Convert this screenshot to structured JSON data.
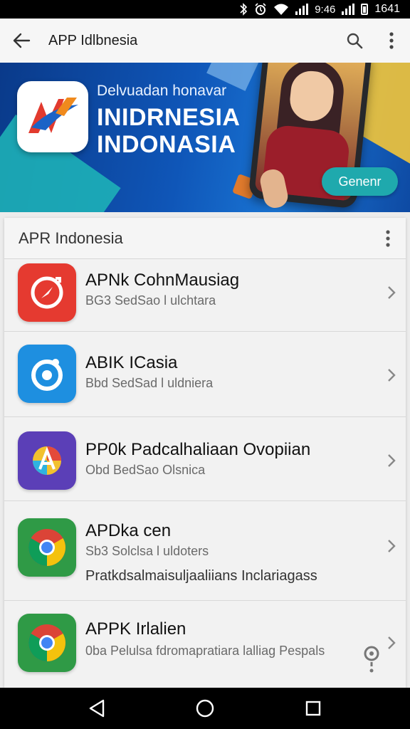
{
  "status_bar": {
    "time": "1641",
    "clock_small": "9:46",
    "icons": [
      "bluetooth-icon",
      "alarm-icon",
      "wifi-icon",
      "signal-icon",
      "signal-icon",
      "battery-icon"
    ]
  },
  "app_bar": {
    "title": "APP Idlbnesia",
    "back_icon": "back-arrow-icon",
    "actions": [
      "search-icon",
      "more-vert-icon"
    ]
  },
  "banner": {
    "subtitle": "Delvuadan honavar",
    "headline_1": "INIDRNESIA",
    "headline_2": "INDONASIA",
    "cta_label": "Genenr"
  },
  "list_card": {
    "title": "APR Indonesia",
    "items": [
      {
        "name": "APNk CohnMausiag",
        "desc": "BG3 SedSao l ulchtara",
        "extra": "",
        "icon": "compass-refresh-icon",
        "color": "#e53a30"
      },
      {
        "name": "ABIK ICasia",
        "desc": "Bbd SedSad l uldniera",
        "extra": "",
        "icon": "ring-camera-icon",
        "color": "#1e8fe0"
      },
      {
        "name": "PP0k Padcalhaliaan Ovopiian",
        "desc": "Obd BedSao Olsnica",
        "extra": "",
        "icon": "letter-a-icon",
        "color": "#5b3fb7"
      },
      {
        "name": "APDka cen",
        "desc": "Sb3 Solclsa l uldoters",
        "extra": "Pratkdsalmaisuljaaliians Inclariagass",
        "icon": "chrome-icon",
        "color": "#2f9a46"
      },
      {
        "name": "APPK Irlalien",
        "desc": "0ba Pelulsa fdromapratiara lalliag Pespals",
        "extra": "",
        "icon": "chrome-icon",
        "color": "#2f9a46"
      }
    ]
  },
  "nav_bar": {
    "buttons": [
      "back-triangle-icon",
      "home-circle-icon",
      "recents-square-icon"
    ]
  }
}
